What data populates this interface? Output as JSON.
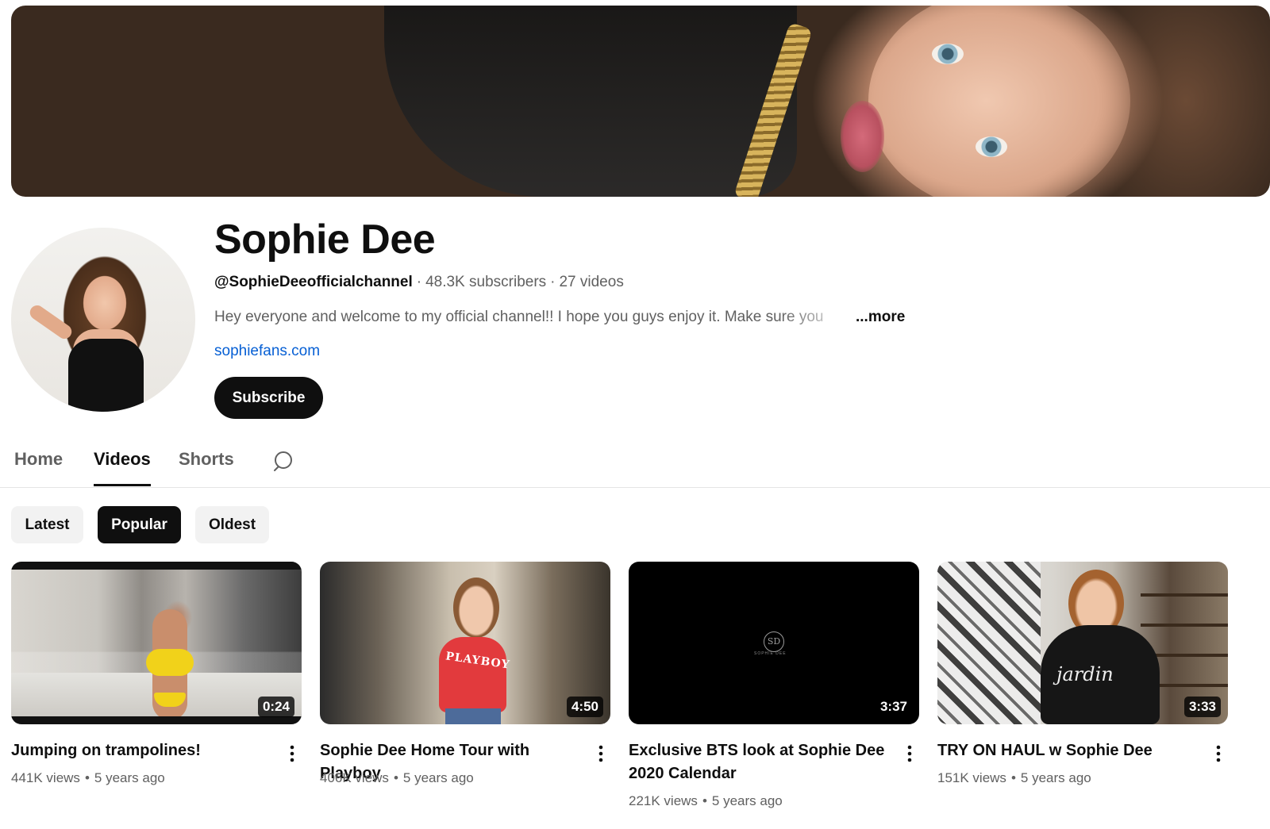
{
  "channel": {
    "name": "Sophie Dee",
    "handle": "@SophieDeeofficialchannel",
    "subscribers": "48.3K subscribers",
    "videos_count": "27 videos",
    "description": "Hey everyone and welcome to my official channel!! I hope you guys enjoy it. Make sure you",
    "more_label": "...more",
    "link": "sophiefans.com",
    "subscribe_label": "Subscribe",
    "meta_separator": "·"
  },
  "tabs": [
    {
      "label": "Home",
      "active": false
    },
    {
      "label": "Videos",
      "active": true
    },
    {
      "label": "Shorts",
      "active": false
    }
  ],
  "icons": {
    "tab_search": "search-icon",
    "video_menu": "more-vert-icon"
  },
  "sort_chips": [
    {
      "label": "Latest",
      "active": false
    },
    {
      "label": "Popular",
      "active": true
    },
    {
      "label": "Oldest",
      "active": false
    }
  ],
  "videos": [
    {
      "title": "Jumping on trampolines!",
      "duration": "0:24",
      "views": "441K views",
      "age": "5 years ago"
    },
    {
      "title": "Sophie Dee Home Tour with Playboy",
      "duration": "4:50",
      "views": "406K views",
      "age": "5 years ago",
      "thumb_text": "PLAYBOY"
    },
    {
      "title": "Exclusive BTS look at Sophie Dee 2020 Calendar",
      "duration": "3:37",
      "views": "221K views",
      "age": "5 years ago",
      "thumb_text": "SD",
      "thumb_subtext": "SOPHIE DEE"
    },
    {
      "title": "TRY ON HAUL w Sophie Dee",
      "duration": "3:33",
      "views": "151K views",
      "age": "5 years ago",
      "thumb_text": "jardin"
    }
  ],
  "meta_dot": "•",
  "colors": {
    "accent_text": "#0f0f0f",
    "secondary_text": "#606060",
    "link": "#065fd4",
    "chip_bg": "#f2f2f2"
  }
}
